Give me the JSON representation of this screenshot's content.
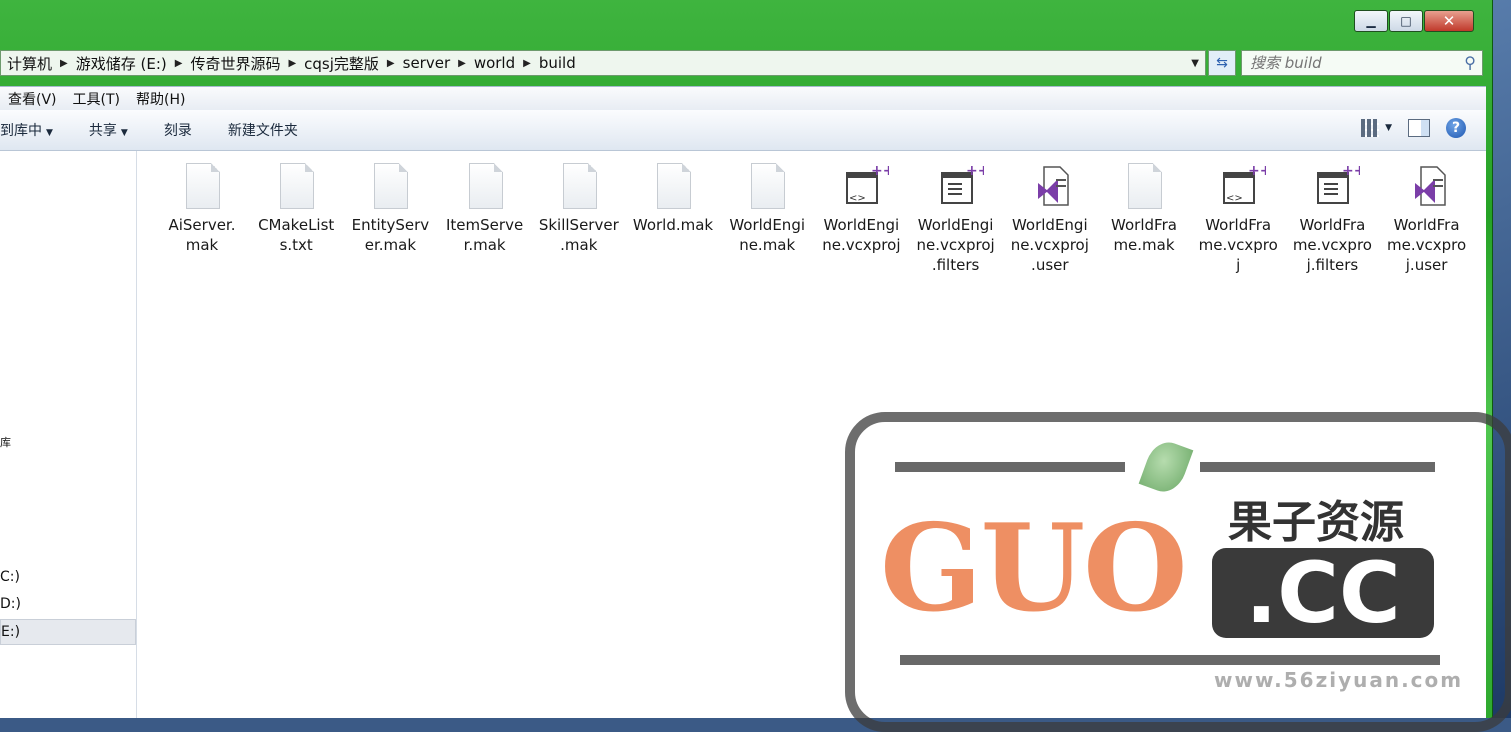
{
  "window": {
    "caption_buttons": {
      "minimize": "▁",
      "maximize": "□",
      "close": "✕"
    }
  },
  "address": {
    "crumbs": [
      "计算机",
      "游戏储存 (E:)",
      "传奇世界源码",
      "cqsj完整版",
      "server",
      "world",
      "build"
    ],
    "search_placeholder": "搜索 build"
  },
  "menu": {
    "view": "查看(V)",
    "tools": "工具(T)",
    "help": "帮助(H)"
  },
  "toolbar": {
    "include_library": "到库中",
    "share": "共享",
    "burn": "刻录",
    "new_folder": "新建文件夹"
  },
  "nav": {
    "items": [
      {
        "label": "库"
      },
      {
        "label": "C:)"
      },
      {
        "label": "D:)"
      },
      {
        "label": "E:)"
      }
    ]
  },
  "files": [
    {
      "name": "AiServer.mak",
      "lines": [
        "AiServer.",
        "mak"
      ],
      "icon": "generic-file-icon"
    },
    {
      "name": "CMakeLists.txt",
      "lines": [
        "CMakeList",
        "s.txt"
      ],
      "icon": "generic-file-icon"
    },
    {
      "name": "EntityServer.mak",
      "lines": [
        "EntityServ",
        "er.mak"
      ],
      "icon": "generic-file-icon"
    },
    {
      "name": "ItemServer.mak",
      "lines": [
        "ItemServe",
        "r.mak"
      ],
      "icon": "generic-file-icon"
    },
    {
      "name": "SkillServer.mak",
      "lines": [
        "SkillServer",
        ".mak"
      ],
      "icon": "generic-file-icon"
    },
    {
      "name": "World.mak",
      "lines": [
        "World.mak"
      ],
      "icon": "generic-file-icon"
    },
    {
      "name": "WorldEngine.mak",
      "lines": [
        "WorldEngi",
        "ne.mak"
      ],
      "icon": "generic-file-icon"
    },
    {
      "name": "WorldEngine.vcxproj",
      "lines": [
        "WorldEngi",
        "ne.vcxproj"
      ],
      "icon": "vcxproj-icon"
    },
    {
      "name": "WorldEngine.vcxproj.filters",
      "lines": [
        "WorldEngi",
        "ne.vcxproj",
        ".filters"
      ],
      "icon": "filters-icon"
    },
    {
      "name": "WorldEngine.vcxproj.user",
      "lines": [
        "WorldEngi",
        "ne.vcxproj",
        ".user"
      ],
      "icon": "visual-studio-icon"
    },
    {
      "name": "WorldFrame.mak",
      "lines": [
        "WorldFra",
        "me.mak"
      ],
      "icon": "generic-file-icon"
    },
    {
      "name": "WorldFrame.vcxproj",
      "lines": [
        "WorldFra",
        "me.vcxpro",
        "j"
      ],
      "icon": "vcxproj-icon"
    },
    {
      "name": "WorldFrame.vcxproj.filters",
      "lines": [
        "WorldFra",
        "me.vcxpro",
        "j.filters"
      ],
      "icon": "filters-icon"
    },
    {
      "name": "WorldFrame.vcxproj.user",
      "lines": [
        "WorldFra",
        "me.vcxpro",
        "j.user"
      ],
      "icon": "visual-studio-icon"
    }
  ],
  "watermark": {
    "guo": "GUO",
    "cn": "果子资源",
    "cc": ".CC",
    "url": "www.56ziyuan.com"
  },
  "colors": {
    "accent_green": "#2ea92e",
    "guo_orange": "#ee8f63",
    "vs_purple": "#7b3ea8"
  }
}
